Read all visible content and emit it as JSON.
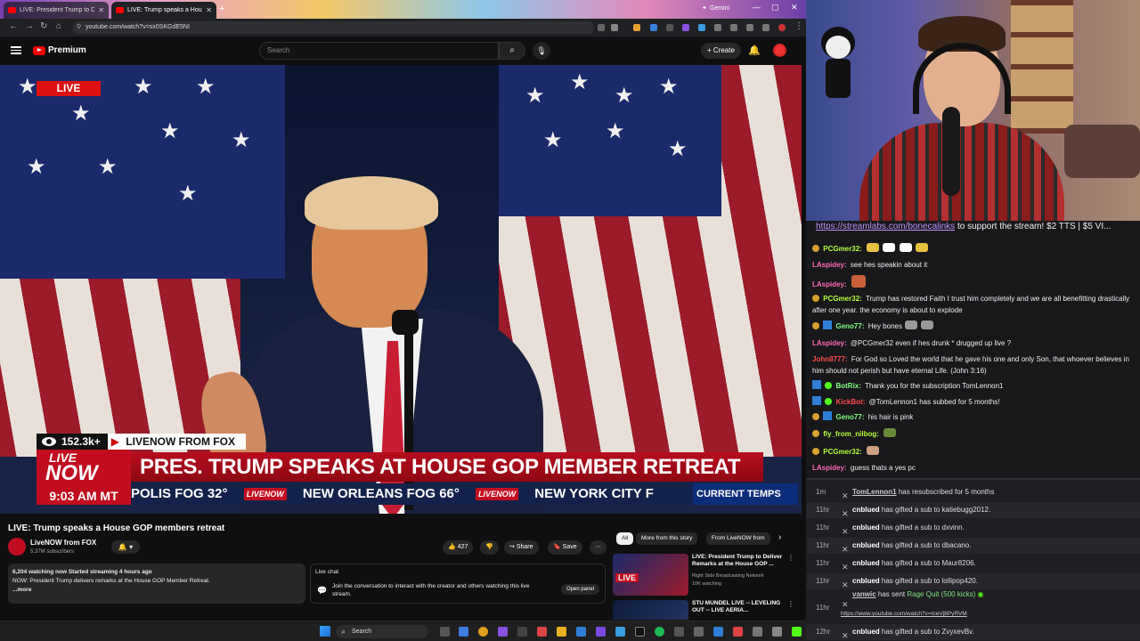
{
  "browser": {
    "tabs": [
      {
        "title": "LIVE: President Trump to D",
        "active": false
      },
      {
        "title": "LIVE: Trump speaks a House",
        "active": true
      }
    ],
    "gemini_label": "Gemini",
    "url": "youtube.com/watch?v=sx0SKGdE5NI"
  },
  "youtube": {
    "logo_text": "Premium",
    "search_placeholder": "Search",
    "create_label": "Create",
    "video": {
      "live_badge": "LIVE",
      "viewers": "152.3k+",
      "source": "LIVENOW FROM FOX",
      "logo_line1": "LIVE",
      "logo_line2": "NOW",
      "headline": "PRES. TRUMP SPEAKS AT HOUSE GOP MEMBER RETREAT",
      "time": "9:03 AM MT",
      "ticker": [
        {
          "text": "POLIS  FOG 32°"
        },
        {
          "text": "NEW ORLEANS  FOG 66°"
        },
        {
          "text": "NEW YORK CITY  F"
        }
      ],
      "ticker_tag": "LIVENOW",
      "current_temps": "CURRENT TEMPS"
    },
    "title": "LIVE: Trump speaks a House GOP members retreat",
    "channel": {
      "name": "LiveNOW from FOX",
      "subscribers": "5.37M subscribers"
    },
    "actions": {
      "likes": "427",
      "share": "Share",
      "save": "Save"
    },
    "description": {
      "line1": "6,204 watching now  Started streaming 4 hours ago",
      "line2": "NOW: President Trump delivers remarks at the House GOP Member Retreat.",
      "more": "...more"
    },
    "live_chat": {
      "title": "Live chat",
      "desc": "Join the conversation to interact with the creator and others watching this live stream.",
      "open_panel": "Open panel"
    },
    "chips": [
      "All",
      "More from this story",
      "From LiveNOW from"
    ],
    "recommendations": [
      {
        "title": "LIVE: President Trump to Deliver Remarks at the House GOP ...",
        "channel": "Right Side Broadcasting Network",
        "meta": "10K watching"
      },
      {
        "title": "STU MUNDEL LIVE -- LEVELING OUT -- LIVE AERIA...",
        "channel": "",
        "meta": ""
      }
    ]
  },
  "taskbar": {
    "search": "Search"
  },
  "chat": {
    "banner_link": "https://streamlabs.com/bonecalinks",
    "banner_rest": " to support the stream! $2 TTS | $5 VI...",
    "messages": [
      {
        "user": "PCGmer32:",
        "color": "#b6ff3d",
        "text": ""
      },
      {
        "user": "LAspidey:",
        "color": "#ff69b4",
        "text": "see hes speakin about it"
      },
      {
        "user": "LAspidey:",
        "color": "#ff69b4",
        "text": ""
      },
      {
        "user": "PCGmer32:",
        "color": "#b6ff3d",
        "text": "Trump has restored Faith I trust him completely and we are all benefitting drastically after one year. the economy is about to explode"
      },
      {
        "user": "Geno77:",
        "color": "#7fff7f",
        "text": "Hey bones"
      },
      {
        "user": "LAspidey:",
        "color": "#ff69b4",
        "text": "@PCGmer32 even if hes drunk * drugged up live ?"
      },
      {
        "user": "John8777:",
        "color": "#ff4a4a",
        "text": "For God so Loved the world that he gave his one and only Son, that whoever believes in him should not perish but have eternal Life. (John 3:16)"
      },
      {
        "user": "BotRix:",
        "color": "#7fff7f",
        "text": "Thank you for the subscription TomLennon1"
      },
      {
        "user": "KickBot:",
        "color": "#ff4a4a",
        "text": "@TomLennon1 has subbed for 5 months!"
      },
      {
        "user": "Geno77:",
        "color": "#7fff7f",
        "text": "his hair is pink"
      },
      {
        "user": "fly_from_nilbog:",
        "color": "#b6ff3d",
        "text": ""
      },
      {
        "user": "PCGmer32:",
        "color": "#b6ff3d",
        "text": ""
      },
      {
        "user": "LAspidey:",
        "color": "#ff69b4",
        "text": "guess thats a yes pc"
      }
    ]
  },
  "events": [
    {
      "time": "1m",
      "user": "TomLennon1",
      "text": " has resubscribed for 5 months",
      "underline": true
    },
    {
      "time": "11hr",
      "user": "cnblued",
      "text": " has gifted a sub to katiebugg2012."
    },
    {
      "time": "11hr",
      "user": "cnblued",
      "text": " has gifted a sub to dxvinn."
    },
    {
      "time": "11hr",
      "user": "cnblued",
      "text": " has gifted a sub to dbacano."
    },
    {
      "time": "11hr",
      "user": "cnblued",
      "text": " has gifted a sub to Maur8206."
    },
    {
      "time": "11hr",
      "user": "cnblued",
      "text": " has gifted a sub to lollipop420."
    },
    {
      "time": "11hr",
      "user": "vanwic",
      "text": " has sent ",
      "highlight": "Rage Quit (500 kicks)",
      "link": "https://www.youtube.com/watch?v=tceVj8PyRVM",
      "underline": true
    },
    {
      "time": "12hr",
      "user": "cnblued",
      "text": " has gifted a sub to ZvyxevBv."
    }
  ]
}
